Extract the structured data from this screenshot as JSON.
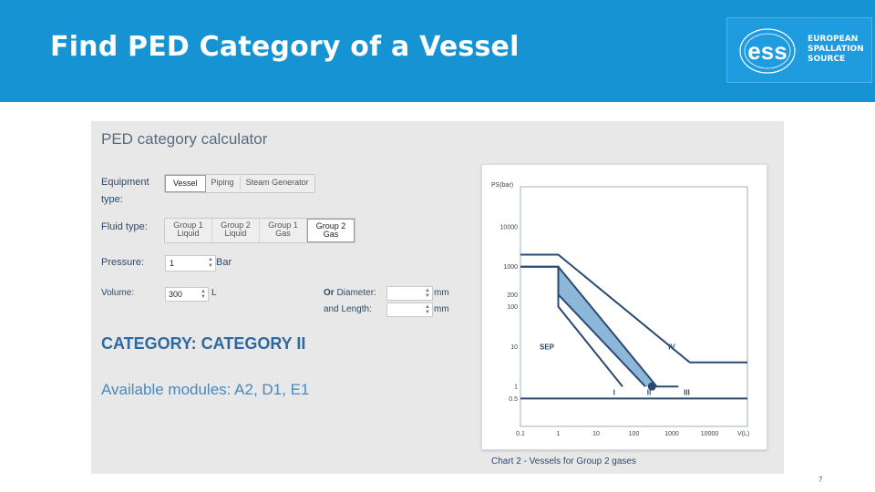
{
  "slide": {
    "title": "Find PED Category of a Vessel",
    "page_number": "7"
  },
  "logo": {
    "mark": "ess",
    "lines": [
      "EUROPEAN",
      "SPALLATION",
      "SOURCE"
    ]
  },
  "calculator": {
    "title": "PED category calculator",
    "equipment_type_label": "Equipment type:",
    "equipment_types": [
      "Vessel",
      "Piping",
      "Steam Generator"
    ],
    "equipment_selected": "Vessel",
    "fluid_type_label": "Fluid type:",
    "fluid_types": [
      {
        "line1": "Group 1",
        "line2": "Liquid"
      },
      {
        "line1": "Group 2",
        "line2": "Liquid"
      },
      {
        "line1": "Group 1",
        "line2": "Gas"
      },
      {
        "line1": "Group 2",
        "line2": "Gas"
      }
    ],
    "fluid_selected_index": 3,
    "pressure_label": "Pressure:",
    "pressure_value": "1",
    "pressure_unit": "Bar",
    "volume_label": "Volume:",
    "volume_value": "300",
    "volume_unit": "L",
    "or_label": "Or",
    "diameter_label": "Diameter:",
    "diameter_value": "",
    "diameter_unit": "mm",
    "length_label": "and Length:",
    "length_value": "",
    "length_unit": "mm",
    "category_text": "CATEGORY: CATEGORY II",
    "modules_text": "Available modules: A2, D1, E1"
  },
  "chart_data": {
    "type": "line",
    "title": "",
    "caption": "Chart 2 - Vessels for Group 2 gases",
    "ylabel": "PS(bar)",
    "xlabel": "V(L)",
    "x_scale": "log",
    "y_scale": "log",
    "xlim": [
      0.1,
      100000
    ],
    "ylim": [
      0.1,
      100000
    ],
    "x_ticks": [
      "0.1",
      "1",
      "10",
      "100",
      "1000",
      "10000"
    ],
    "y_ticks": [
      "10000",
      "1000",
      "200",
      "100",
      "10",
      "1",
      "0.5"
    ],
    "region_labels": [
      "SEP",
      "I",
      "II",
      "III",
      "IV"
    ],
    "series": [
      {
        "values": [
          [
            0.1,
            0.5
          ],
          [
            100000,
            0.5
          ]
        ]
      },
      {
        "values": [
          [
            0.1,
            1000
          ],
          [
            1,
            1000
          ],
          [
            1,
            200
          ],
          [
            20,
            10
          ],
          [
            200,
            1
          ]
        ]
      },
      {
        "values": [
          [
            1,
            200
          ],
          [
            1,
            100
          ],
          [
            50,
            1
          ]
        ]
      },
      {
        "values": [
          [
            0.1,
            1000
          ],
          [
            1,
            1000
          ],
          [
            400,
            1
          ],
          [
            1500,
            1
          ]
        ]
      },
      {
        "values": [
          [
            0.1,
            2000
          ],
          [
            1,
            2000
          ],
          [
            3000,
            4
          ],
          [
            100000,
            4
          ]
        ]
      }
    ],
    "selected_point": {
      "x": 300,
      "y": 1
    },
    "colors": {
      "line": "#2b4a6f",
      "band": "#8cb7d9",
      "point": "#2b4a6f"
    },
    "grid": false,
    "legend": "none"
  }
}
